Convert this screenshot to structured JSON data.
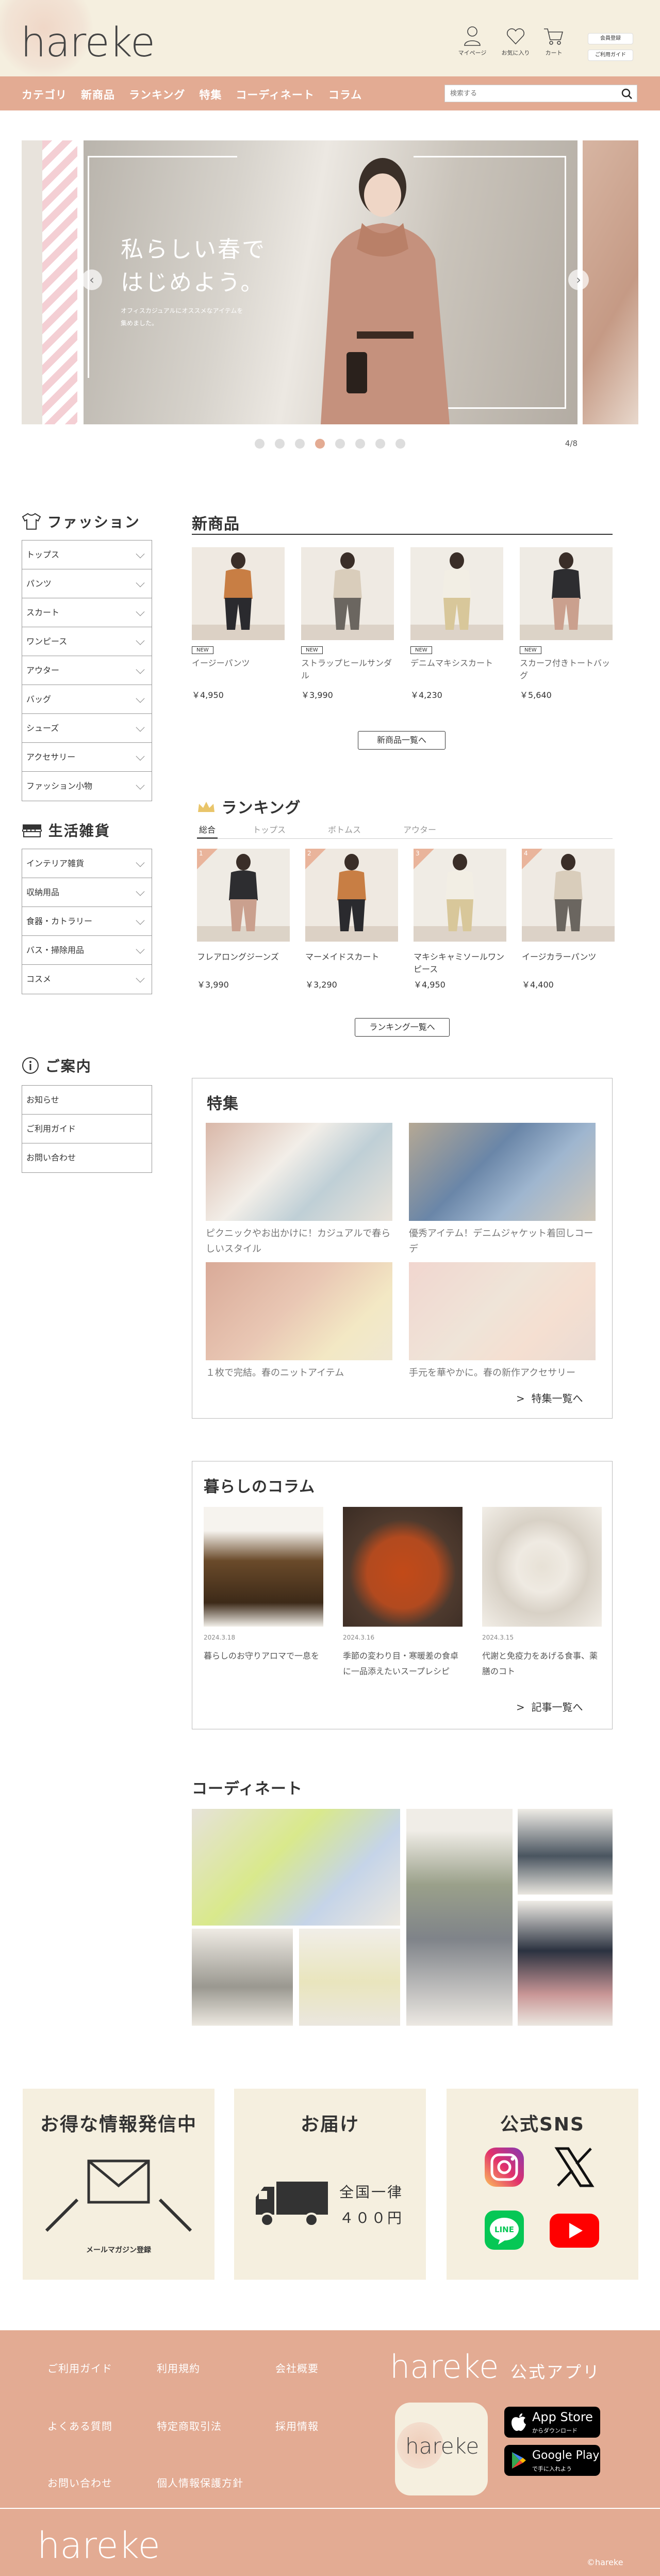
{
  "header": {
    "logo": "hareke",
    "icons": [
      {
        "label": "マイページ",
        "icon": "user-icon"
      },
      {
        "label": "お気に入り",
        "icon": "heart-icon"
      },
      {
        "label": "カート",
        "icon": "cart-icon"
      }
    ],
    "register_label": "会員登録",
    "guide_label": "ご利用ガイド"
  },
  "nav": {
    "items": [
      "カテゴリ",
      "新商品",
      "ランキング",
      "特集",
      "コーディネート",
      "コラム"
    ],
    "search_placeholder": "検索する"
  },
  "hero": {
    "title": "私らしい春で\nはじめよう。",
    "subtitle": "オフィスカジュアルにオススメなアイテムを集めました。",
    "counter": "4/8",
    "dots": 8,
    "active_dot": 4
  },
  "sidebar": {
    "fashion_title": "ファッション",
    "fashion_items": [
      "トップス",
      "パンツ",
      "スカート",
      "ワンピース",
      "アウター",
      "バッグ",
      "シューズ",
      "アクセサリー",
      "ファッション小物"
    ],
    "life_title": "生活雑貨",
    "life_items": [
      "インテリア雑貨",
      "収納用品",
      "食器・カトラリー",
      "バス・掃除用品",
      "コスメ"
    ],
    "info_title": "ご案内",
    "info_items": [
      "お知らせ",
      "ご利用ガイド",
      "お問い合わせ"
    ]
  },
  "new_products": {
    "title": "新商品",
    "badge": "NEW",
    "items": [
      {
        "name": "イージーパンツ",
        "price": "￥4,950"
      },
      {
        "name": "ストラップヒールサンダル",
        "price": "￥3,990"
      },
      {
        "name": "デニムマキシスカート",
        "price": "￥4,230"
      },
      {
        "name": "スカーフ付きトートバッグ",
        "price": "￥5,640"
      }
    ],
    "more": "新商品一覧へ"
  },
  "ranking": {
    "title": "ランキング",
    "tabs": [
      "総合",
      "トップス",
      "ボトムス",
      "アウター"
    ],
    "items": [
      {
        "rank": "1",
        "name": "フレアロングジーンズ",
        "price": "￥3,990"
      },
      {
        "rank": "2",
        "name": "マーメイドスカート",
        "price": "￥3,290"
      },
      {
        "rank": "3",
        "name": "マキシキャミソールワンピース",
        "price": "￥4,950"
      },
      {
        "rank": "4",
        "name": "イージカラーパンツ",
        "price": "￥4,400"
      }
    ],
    "more": "ランキング一覧へ"
  },
  "features": {
    "title": "特集",
    "items": [
      {
        "caption": "ピクニックやお出かけに！カジュアルで春らしいスタイル"
      },
      {
        "caption": "優秀アイテム！デニムジャケット着回しコーデ"
      },
      {
        "caption": "１枚で完結。春のニットアイテム"
      },
      {
        "caption": "手元を華やかに。春の新作アクセサリー"
      }
    ],
    "more": "特集一覧へ"
  },
  "columns": {
    "title": "暮らしのコラム",
    "items": [
      {
        "date": "2024.3.18",
        "text": "暮らしのお守りアロマで一息を"
      },
      {
        "date": "2024.3.16",
        "text": "季節の変わり目・寒暖差の食卓に一品添えたいスープレシピ"
      },
      {
        "date": "2024.3.15",
        "text": "代謝と免疫力をあげる食事、薬膳のコト"
      }
    ],
    "more": "記事一覧へ"
  },
  "coordinate": {
    "title": "コーディネート"
  },
  "info_boxes": {
    "newsletter_title": "お得な情報発信中",
    "newsletter_label": "メールマガジン登録",
    "delivery_title": "お届け",
    "delivery_text": "全国一律\n４００円",
    "sns_title": "公式SNS"
  },
  "footer": {
    "links": [
      "ご利用ガイド",
      "利用規約",
      "会社概要",
      "よくある質問",
      "特定商取引法",
      "採用情報",
      "お問い合わせ",
      "個人情報保護方針"
    ],
    "app_logo": "hareke",
    "app_title": "公式アプリ",
    "app_icon_text": "hareke",
    "appstore_small": "",
    "appstore_big": "App Store",
    "appstore_sub": "からダウンロード",
    "googleplay_small": "",
    "googleplay_big": "Google Play",
    "googleplay_sub": "で手に入れよう",
    "logo": "hareke",
    "copyright": "©hareke"
  },
  "colors": {
    "accent": "#e3ab93",
    "cream": "#f5efdf",
    "pink": "#f4cfd4"
  }
}
